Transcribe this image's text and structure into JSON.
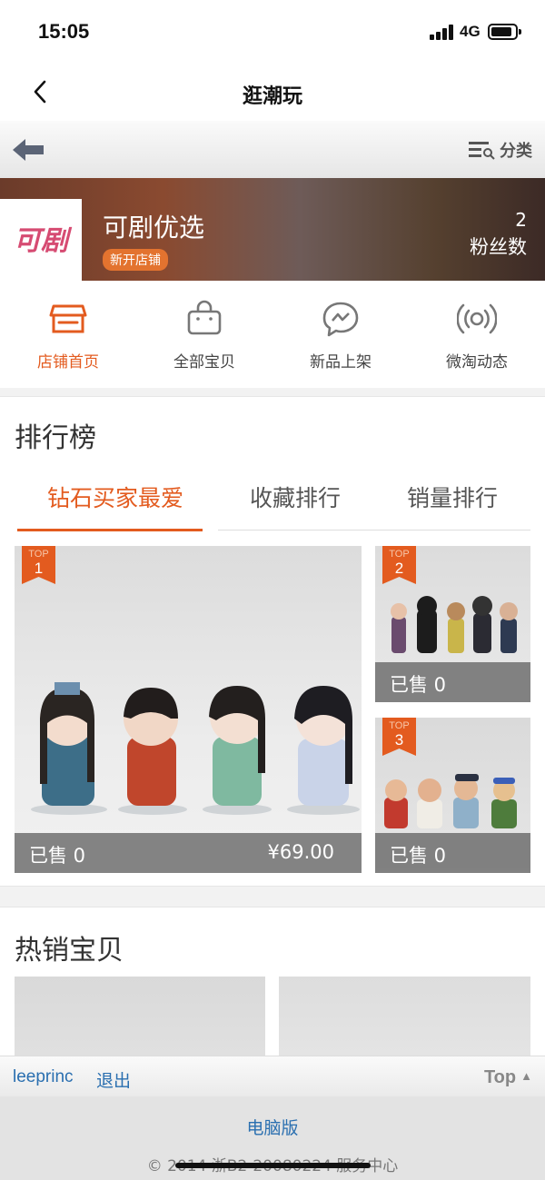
{
  "status_bar": {
    "time": "15:05",
    "network": "4G"
  },
  "nav": {
    "title": "逛潮玩"
  },
  "shop_toolbar": {
    "category_label": "分类"
  },
  "shop": {
    "name": "可剧优选",
    "badge": "新开店铺",
    "logo_text": "可剧",
    "fans_count": "2",
    "fans_label": "粉丝数"
  },
  "menu": [
    {
      "label": "店铺首页",
      "icon": "store-icon",
      "active": true
    },
    {
      "label": "全部宝贝",
      "icon": "bag-icon",
      "active": false
    },
    {
      "label": "新品上架",
      "icon": "chat-bubble-icon",
      "active": false
    },
    {
      "label": "微淘动态",
      "icon": "broadcast-icon",
      "active": false
    }
  ],
  "ranking": {
    "title": "排行榜",
    "tabs": [
      "钻石买家最爱",
      "收藏排行",
      "销量排行"
    ],
    "active_tab": 0,
    "products": [
      {
        "rank_top": "TOP",
        "rank_num": "1",
        "sold": "已售 0",
        "price": "¥69.00"
      },
      {
        "rank_top": "TOP",
        "rank_num": "2",
        "sold": "已售 0"
      },
      {
        "rank_top": "TOP",
        "rank_num": "3",
        "sold": "已售 0"
      }
    ]
  },
  "hot": {
    "title": "热销宝贝"
  },
  "user_bar": {
    "username": "leeprinc",
    "logout": "退出",
    "top": "Top"
  },
  "footer": {
    "pc_link": "电脑版",
    "copyright": "© 2014 浙B2-20080224 服务中心"
  },
  "colors": {
    "accent": "#e35b1f",
    "link": "#2a6fb0",
    "badge": "#e3732f"
  }
}
